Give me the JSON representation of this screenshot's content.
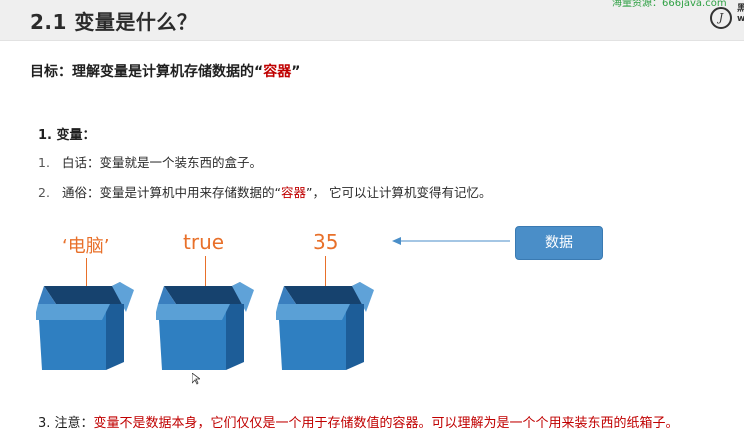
{
  "header": {
    "title": "2.1 变量是什么？",
    "watermark": "海量资源：666java.com",
    "logo_glyph": "J",
    "logo_cut": "黑 w"
  },
  "goal": {
    "prefix": "目标：理解变量是计算机存储数据的“",
    "highlight": "容器",
    "suffix": "”"
  },
  "section": {
    "heading": "1. 变量：",
    "items": [
      {
        "num": "1.",
        "text": "白话：变量就是一个装东西的盒子。"
      },
      {
        "num": "2.",
        "prefix": "通俗：变量是计算机中用来存储数据的“",
        "highlight": "容器",
        "suffix": "”， 它可以让计算机变得有记忆。"
      }
    ]
  },
  "boxes": [
    {
      "label": "‘电脑’"
    },
    {
      "label": "true"
    },
    {
      "label": "35"
    }
  ],
  "data_button": {
    "label": "数据"
  },
  "note": {
    "lead": "3. 注意：",
    "text": "变量不是数据本身，它们仅仅是一个用于存储数值的容器。可以理解为是一个个用来装东西的纸箱子。"
  },
  "colors": {
    "accent_red": "#c00000",
    "label_orange": "#e8702a",
    "box_blue": "#2f7fc1",
    "data_blue": "#4a8ec8"
  }
}
